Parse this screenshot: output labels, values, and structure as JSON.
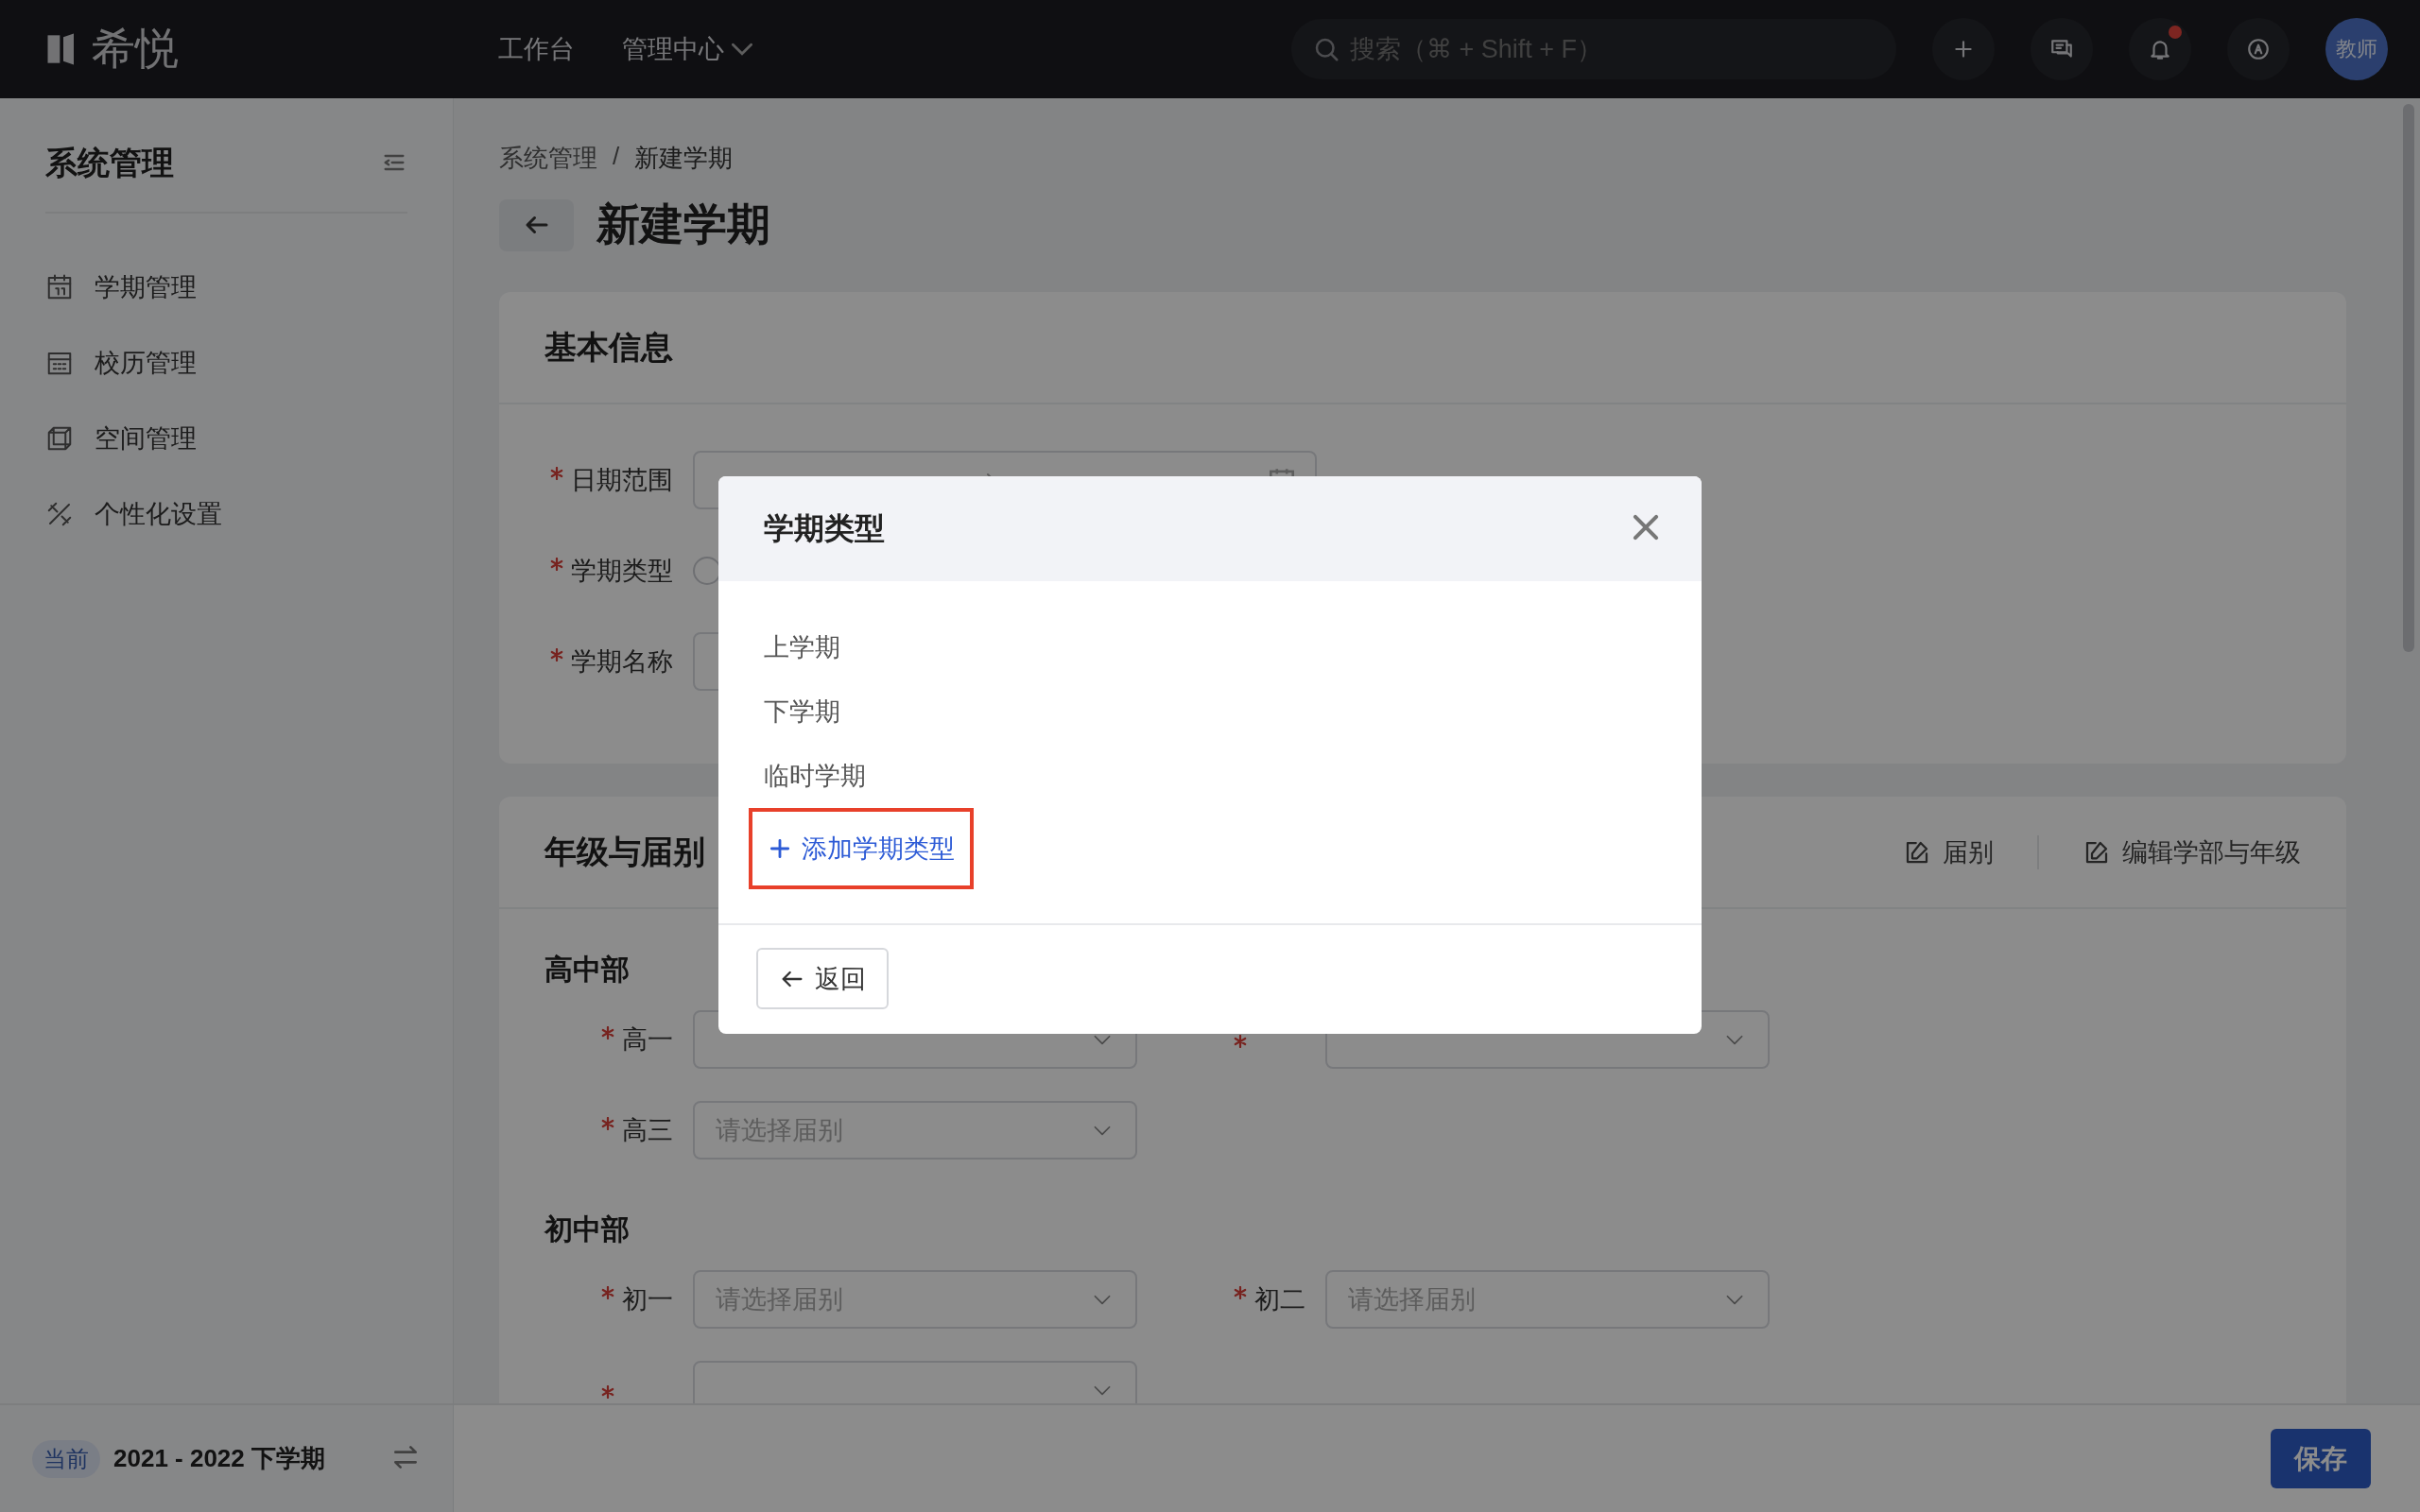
{
  "topbar": {
    "logo": "希悦",
    "nav": [
      {
        "label": "工作台",
        "dropdown": false
      },
      {
        "label": "管理中心",
        "dropdown": true
      }
    ],
    "search": {
      "placeholder": "搜索（⌘ + Shift + F）"
    },
    "notifications_unread": true,
    "avatar": "教师"
  },
  "sidebar": {
    "title": "系统管理",
    "items": [
      {
        "label": "学期管理",
        "kind": "calendar"
      },
      {
        "label": "校历管理",
        "kind": "grid"
      },
      {
        "label": "空间管理",
        "kind": "cube"
      },
      {
        "label": "个性化设置",
        "kind": "tools"
      }
    ],
    "current": {
      "badge": "当前",
      "term": "2021 - 2022 下学期"
    }
  },
  "breadcrumb": {
    "items": [
      "系统管理",
      "新建学期"
    ],
    "separator": "/"
  },
  "page_title": "新建学期",
  "basic_info": {
    "title": "基本信息",
    "fields": [
      {
        "kind": "date-range",
        "label": "日期范围",
        "required": true
      },
      {
        "kind": "radio",
        "label": "学期类型",
        "required": true,
        "checked": false
      },
      {
        "kind": "text",
        "label": "学期名称",
        "required": true
      }
    ]
  },
  "grades": {
    "title": "年级与届别",
    "actions": [
      "届别",
      "编辑学部与年级"
    ],
    "sections": [
      {
        "title": "高中部",
        "fields": [
          {
            "label": "高一",
            "required": true
          },
          {
            "required": true
          },
          {
            "label": "高三",
            "required": true,
            "placeholder": "请选择届别"
          }
        ]
      },
      {
        "title": "初中部",
        "fields": [
          {
            "label": "初一",
            "required": true,
            "placeholder": "请选择届别"
          },
          {
            "label": "初二",
            "required": true,
            "placeholder": "请选择届别"
          },
          {
            "required": true
          }
        ]
      }
    ]
  },
  "footer": {
    "save": "保存"
  },
  "modal": {
    "title": "学期类型",
    "options": [
      "上学期",
      "下学期",
      "临时学期"
    ],
    "add": {
      "label": "添加学期类型",
      "highlighted": true
    },
    "back": "返回"
  }
}
